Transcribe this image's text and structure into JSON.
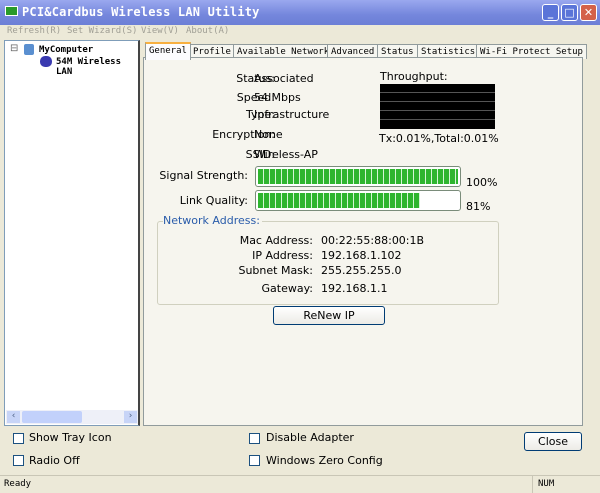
{
  "window": {
    "title": "PCI&Cardbus Wireless LAN Utility",
    "minimize": "_",
    "maximize": "□",
    "close": "✕"
  },
  "menu": [
    "Refresh(R)",
    "Set Wizard(S)",
    "View(V)",
    "About(A)"
  ],
  "tree": {
    "root": "MyComputer",
    "child": "54M Wireless LAN",
    "expander": "⊟"
  },
  "tabs": [
    "General",
    "Profile",
    "Available Network",
    "Advanced",
    "Status",
    "Statistics",
    "Wi-Fi Protect Setup"
  ],
  "general": {
    "status_label": "Status:",
    "status": "Associated",
    "speed_label": "Speed:",
    "speed": "54 Mbps",
    "type_label": "Type:",
    "type": "Infrastructure",
    "encryption_label": "Encryption:",
    "encryption": "None",
    "ssid_label": "SSID:",
    "ssid": "Wireless-AP",
    "throughput_label": "Throughput:",
    "throughput_text": "Tx:0.01%,Total:0.01%",
    "signal_label": "Signal Strength:",
    "signal_value": 100,
    "signal_text": "100%",
    "link_label": "Link Quality:",
    "link_value": 81,
    "link_text": "81%",
    "network": {
      "title": "Network Address:",
      "mac_label": "Mac Address:",
      "mac": "00:22:55:88:00:1B",
      "ip_label": "IP Address:",
      "ip": "192.168.1.102",
      "mask_label": "Subnet Mask:",
      "mask": "255.255.255.0",
      "gw_label": "Gateway:",
      "gw": "192.168.1.1"
    },
    "renew": "ReNew IP"
  },
  "options": {
    "tray": "Show Tray Icon",
    "radio": "Radio Off",
    "disable": "Disable Adapter",
    "wzc": "Windows Zero Config",
    "close": "Close"
  },
  "statusbar": {
    "text": "Ready",
    "num": "NUM"
  },
  "colors": {
    "accent": "#7486dc",
    "green": "#2fb52f",
    "group_title": "#2a5caa"
  }
}
